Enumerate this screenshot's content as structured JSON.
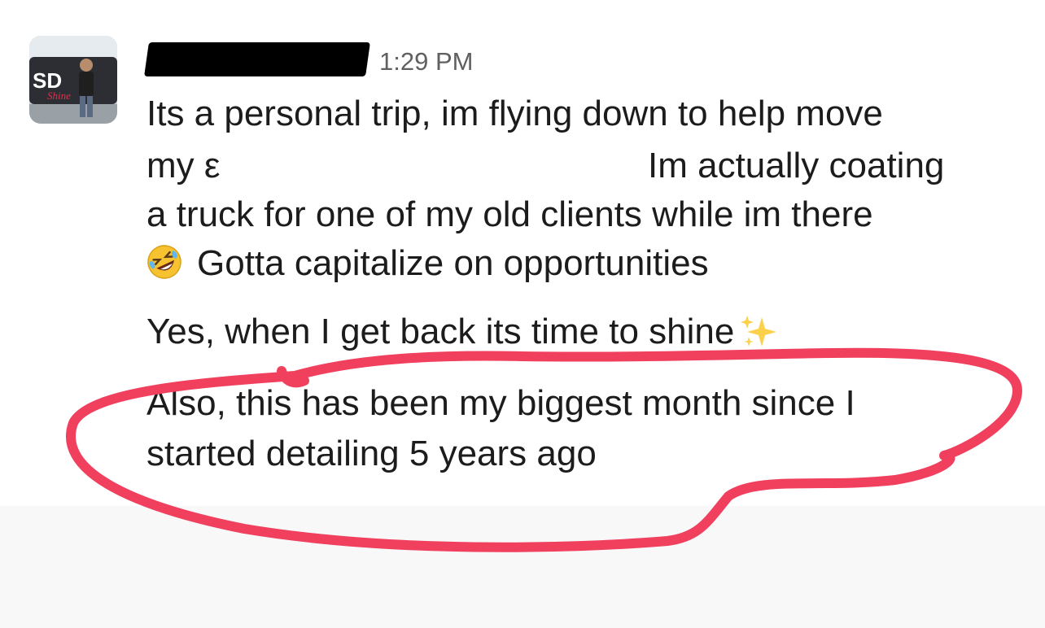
{
  "message": {
    "sender_avatar_alt": "SD Shine",
    "timestamp": "1:29 PM",
    "lines": [
      "Its a personal trip, im flying down to help move",
      "my ε",
      "Im actually coating",
      "a truck for one of my old clients while im there",
      "Gotta capitalize on opportunities",
      "Yes, when I get back its time to shine",
      "Also, this has been my biggest month since I",
      "started detailing 5 years ago"
    ],
    "emojis": [
      "rolling-on-floor-laughing-emoji",
      "sparkles-emoji"
    ]
  },
  "annotation": {
    "color": "#f0405e",
    "shape": "hand-drawn-circle"
  },
  "colors": {
    "text": "#1d1c1d",
    "timestamp": "#616061",
    "background": "#ffffff"
  }
}
